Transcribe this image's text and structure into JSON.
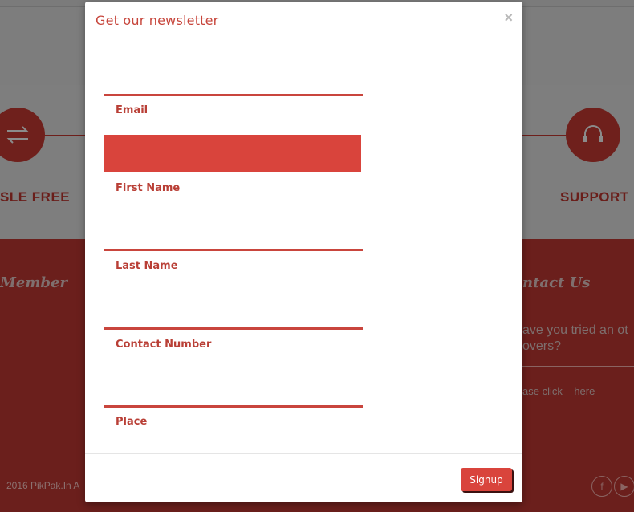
{
  "background": {
    "features": [
      {
        "label": "SLE FREE",
        "icon": "exchange-arrows-icon"
      },
      {
        "label": "SUPPORT",
        "icon": "headset-icon"
      }
    ],
    "footer": {
      "left_heading": "Member",
      "right_heading": "ntact Us",
      "question_line1": "ave you tried an ot",
      "question_line2": "overs?",
      "click_text": "ase click",
      "click_link": "here",
      "copyright": "2016  PikPak.In A"
    },
    "social": [
      {
        "icon": "facebook-icon",
        "glyph": "f"
      },
      {
        "icon": "youtube-icon",
        "glyph": "▶"
      }
    ]
  },
  "modal": {
    "title": "Get our newsletter",
    "close_glyph": "×",
    "fields": [
      {
        "name": "email",
        "label": "Email",
        "value": ""
      },
      {
        "name": "first_name",
        "label": "First Name",
        "value": ""
      },
      {
        "name": "last_name",
        "label": "Last Name",
        "value": ""
      },
      {
        "name": "contact_number",
        "label": "Contact Number",
        "value": ""
      },
      {
        "name": "place",
        "label": "Place",
        "value": ""
      }
    ],
    "submit_label": "Signup"
  },
  "colors": {
    "accent": "#d9443c",
    "title": "#c7463c",
    "label": "#b93f36"
  }
}
